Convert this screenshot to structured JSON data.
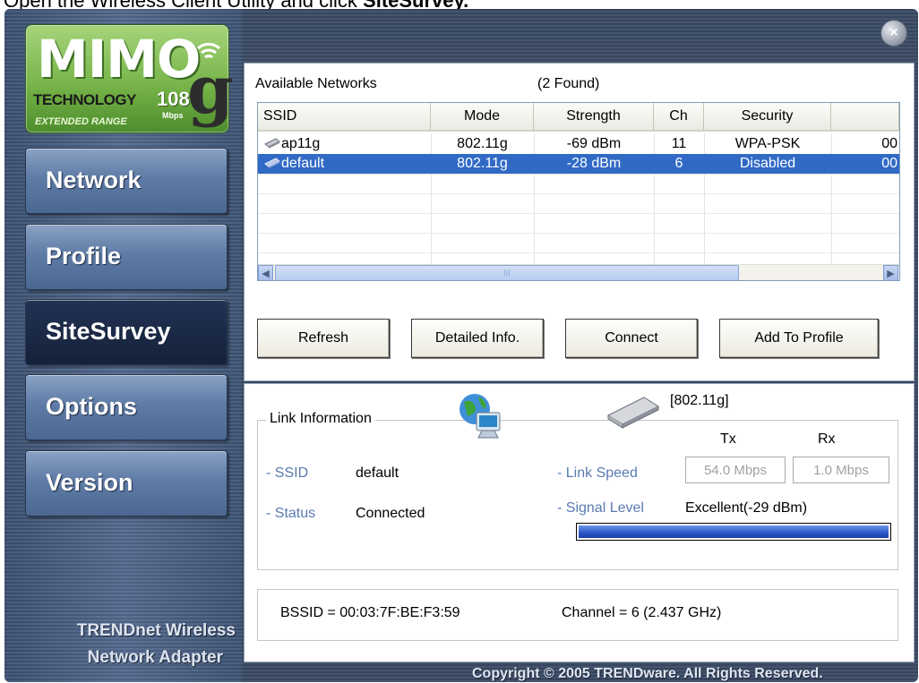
{
  "caption": {
    "prefix": "Open the Wireless Client Utility and click ",
    "bold": "SiteSurvey."
  },
  "logo": {
    "word": "MIMO",
    "tech": "TECHNOLOGY",
    "speed": "108",
    "letter": "g",
    "mbps": "Mbps",
    "range": "EXTENDED RANGE"
  },
  "nav": [
    {
      "label": "Network"
    },
    {
      "label": "Profile"
    },
    {
      "label": "SiteSurvey"
    },
    {
      "label": "Options"
    },
    {
      "label": "Version"
    }
  ],
  "brand": {
    "line1": "TRENDnet Wireless",
    "line2": "Network Adapter"
  },
  "survey": {
    "title": "Available Networks",
    "found": "(2 Found)",
    "columns": [
      "SSID",
      "Mode",
      "Strength",
      "Ch",
      "Security",
      ""
    ],
    "rows": [
      {
        "ssid": "ap11g",
        "mode": "802.11g",
        "strength": "-69 dBm",
        "ch": "11",
        "security": "WPA-PSK",
        "extra": "00"
      },
      {
        "ssid": "default",
        "mode": "802.11g",
        "strength": "-28 dBm",
        "ch": "6",
        "security": "Disabled",
        "extra": "00"
      }
    ],
    "selected_row": 1,
    "scroll_grip": "III"
  },
  "buttons": {
    "refresh": "Refresh",
    "detailed": "Detailed Info.",
    "connect": "Connect",
    "add_profile": "Add To Profile"
  },
  "link": {
    "group_title": "Link Information",
    "mode_tag": "[802.11g]",
    "tx_header": "Tx",
    "rx_header": "Rx",
    "ssid_label": "- SSID",
    "ssid_value": "default",
    "status_label": "- Status",
    "status_value": "Connected",
    "speed_label": "- Link Speed",
    "tx_value": "54.0 Mbps",
    "rx_value": "1.0 Mbps",
    "signal_label": "- Signal Level",
    "signal_value": "Excellent(-29 dBm)",
    "signal_fraction": 1.0
  },
  "info": {
    "bssid": "BSSID = 00:03:7F:BE:F3:59",
    "channel": "Channel = 6 (2.437 GHz)"
  },
  "copyright": "Copyright © 2005 TRENDware. All Rights Reserved.",
  "colors": {
    "selected_row": "#316ac5",
    "nav_active": "#1b2a47",
    "label_blue": "#5a7bb0",
    "logo_green": "#78b54a"
  }
}
